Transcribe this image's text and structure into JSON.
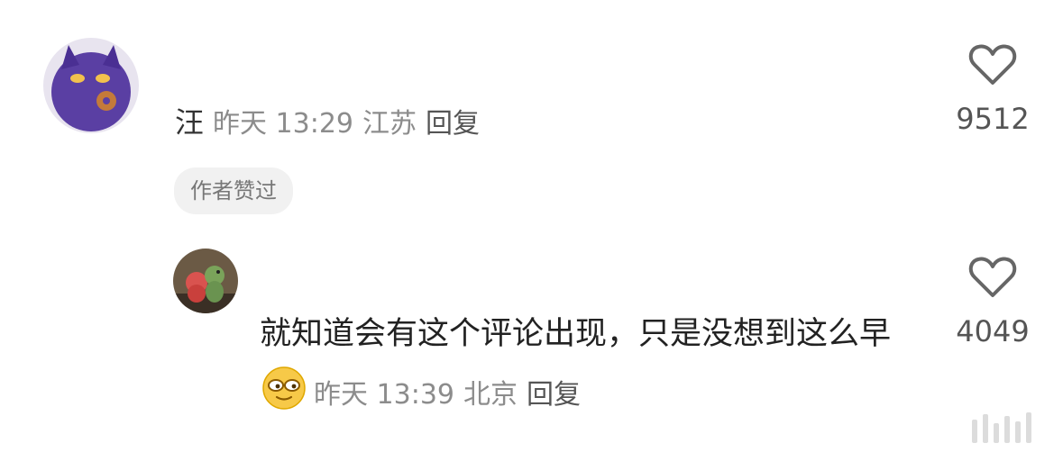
{
  "comment": {
    "author": "汪",
    "time": "昨天 13:29",
    "location": "江苏",
    "reply_label": "回复",
    "likes": "9512",
    "author_liked_badge": "作者赞过"
  },
  "reply": {
    "text": "就知道会有这个评论出现，只是没想到这么早",
    "time": "昨天 13:39",
    "location": "北京",
    "reply_label": "回复",
    "likes": "4049",
    "emoji": "smirk-glasses-emoji"
  },
  "icons": {
    "like": "heart-outline-icon"
  },
  "colors": {
    "meta_text": "#8c8c8c",
    "badge_bg": "#f1f1f1",
    "content_text": "#222222"
  }
}
